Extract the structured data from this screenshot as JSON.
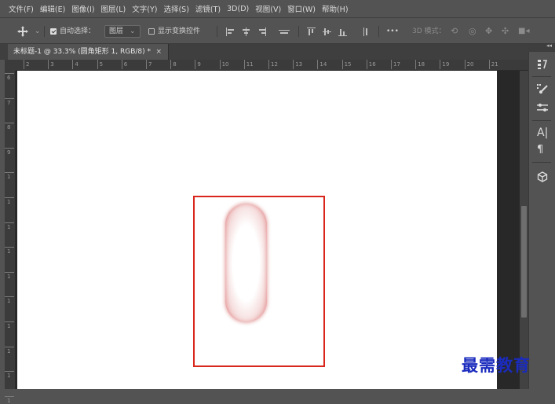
{
  "menu": [
    "文件(F)",
    "编辑(E)",
    "图像(I)",
    "图层(L)",
    "文字(Y)",
    "选择(S)",
    "滤镜(T)",
    "3D(D)",
    "视图(V)",
    "窗口(W)",
    "帮助(H)"
  ],
  "options": {
    "move_icon": "move-icon",
    "auto_select_label": "自动选择：",
    "auto_select_checked": true,
    "auto_select_target": "图层",
    "show_transform_label": "显示变换控件",
    "show_transform_checked": false,
    "more_label": "•••",
    "mode_3d_label": "3D 模式："
  },
  "document_tab": {
    "title": "未标题-1 @ 33.3% (圆角矩形 1, RGB/8) *",
    "close": "×"
  },
  "ruler": {
    "horizontal": [
      "2",
      "3",
      "4",
      "5",
      "6",
      "7",
      "8",
      "9",
      "10",
      "11",
      "12",
      "13",
      "14",
      "15",
      "16",
      "17",
      "18",
      "19",
      "20",
      "21"
    ],
    "vertical": [
      "6",
      "7",
      "8",
      "9",
      "1",
      "1",
      "1",
      "1",
      "1",
      "1",
      "1",
      "1",
      "1",
      "1"
    ]
  },
  "right_panel": {
    "collapse_label": "◂◂",
    "icons": [
      "history-icon",
      "brush-icon",
      "adjustments-icon",
      "character-icon",
      "paragraph-icon",
      "3d-cube-icon"
    ]
  },
  "colors": {
    "selection": "#d9261c",
    "watermark": "#1a2bbd"
  },
  "watermark": "最需教育"
}
